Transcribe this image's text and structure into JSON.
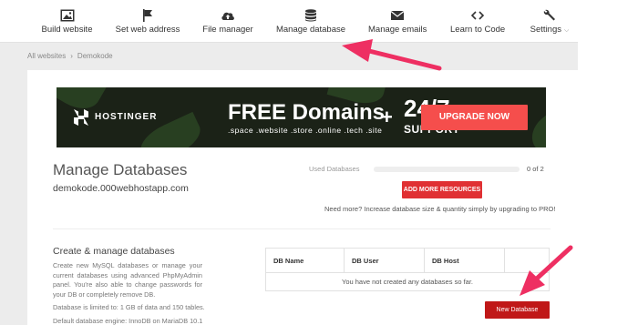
{
  "nav": {
    "items": [
      {
        "label": "Build website"
      },
      {
        "label": "Set web address"
      },
      {
        "label": "File manager"
      },
      {
        "label": "Manage database"
      },
      {
        "label": "Manage emails"
      },
      {
        "label": "Learn to Code"
      },
      {
        "label": "Settings"
      }
    ]
  },
  "breadcrumb": {
    "root": "All websites",
    "current": "Demokode"
  },
  "banner": {
    "brand": "HOSTINGER",
    "headline": "FREE Domains",
    "tlds": ".space .website .store .online .tech .site",
    "plus": "+",
    "hours": "24/7",
    "support": "SUPPORT",
    "cta": "UPGRADE NOW"
  },
  "manage": {
    "title": "Manage Databases",
    "host": "demokode.000webhostapp.com",
    "used_label": "Used Databases",
    "used_count": "0 of 2",
    "used_fraction": 0,
    "add_button": "ADD MORE RESOURCES",
    "need_more": "Need more? Increase database size & quantity simply by upgrading to PRO!"
  },
  "info": {
    "title": "Create & manage databases",
    "description": "Create new MySQL databases or manage your current databases using advanced PhpMyAdmin panel. You're also able to change passwords for your DB or completely remove DB.",
    "limit": "Database is limited to: 1 GB of data and 150 tables.",
    "engine": "Default database engine: InnoDB on MariaDB 10.1"
  },
  "table": {
    "headers": [
      "DB Name",
      "DB User",
      "DB Host"
    ],
    "empty": "You have not created any databases so far."
  },
  "new_db_button": "New Database",
  "colors": {
    "accent": "#e03033",
    "arrow": "#ee2f62",
    "banner_cta": "#f54e4c"
  }
}
